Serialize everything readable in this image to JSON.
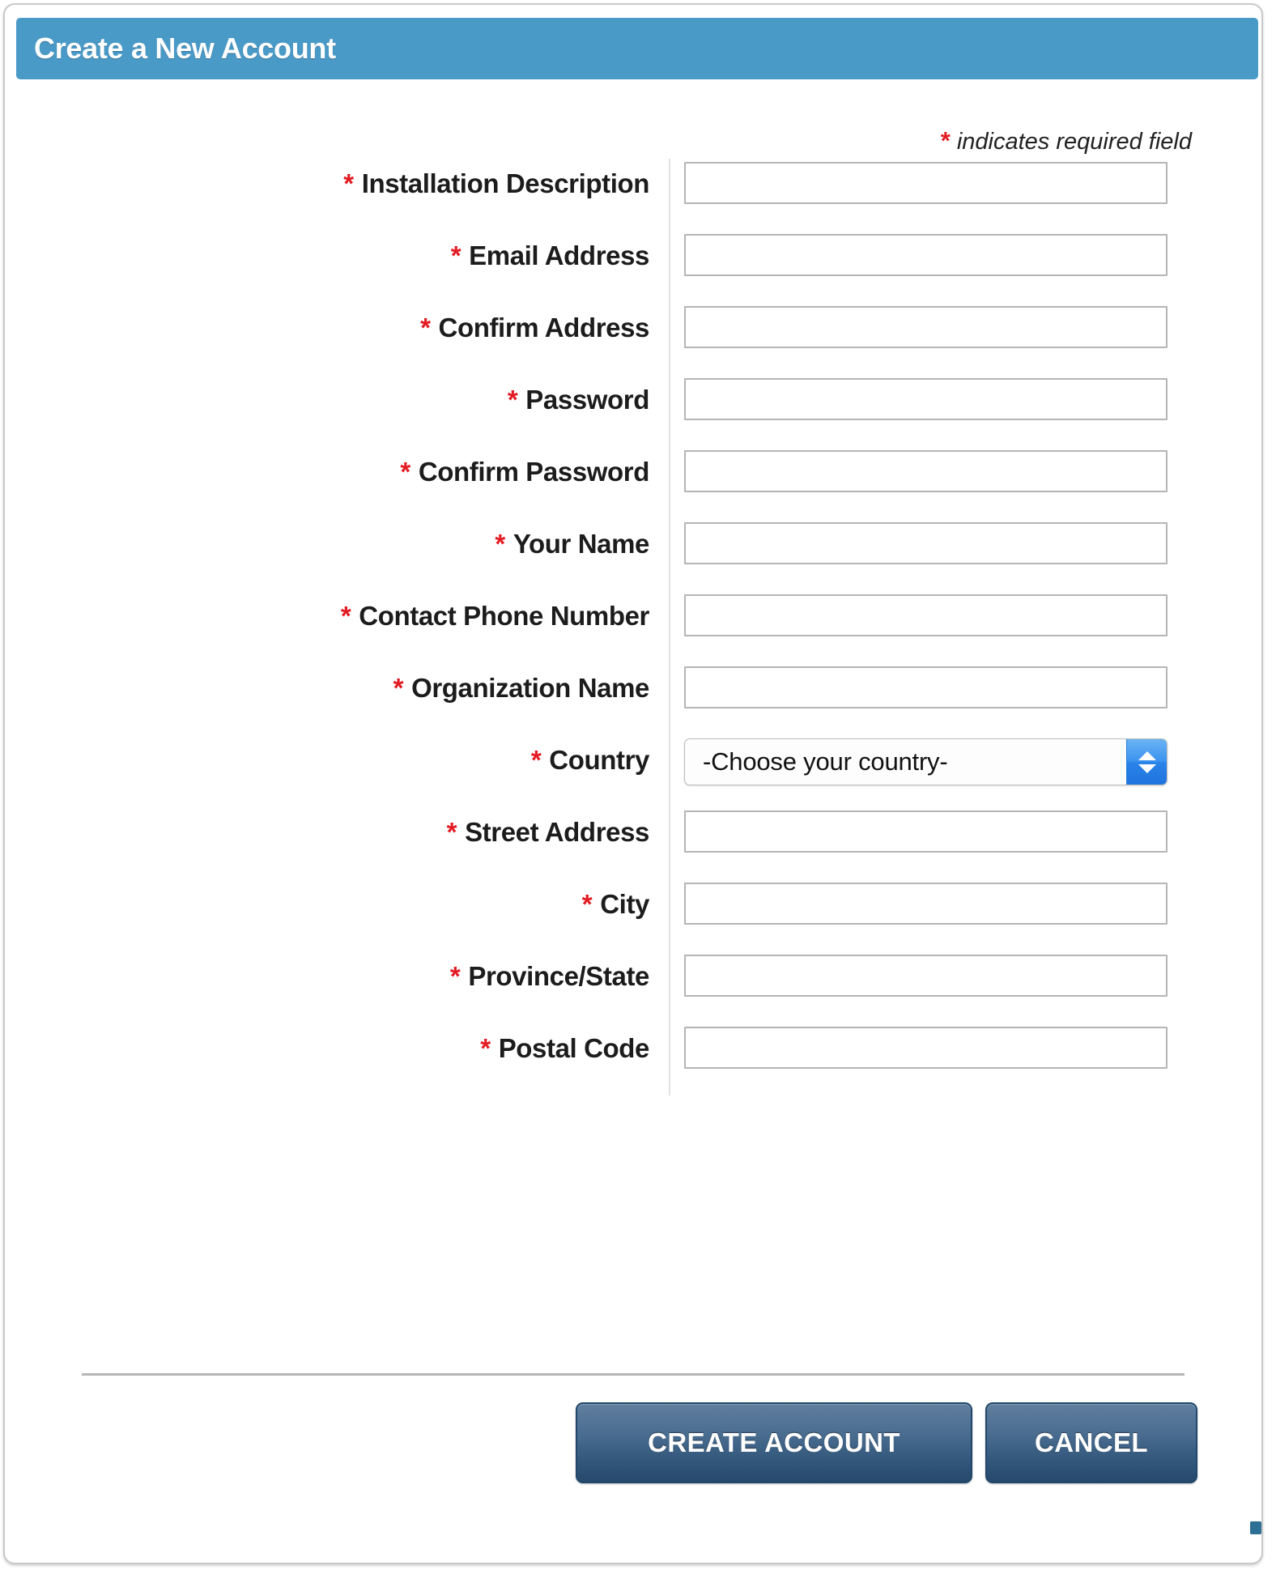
{
  "header": {
    "title": "Create a New Account",
    "background_color": "#4a9ac8",
    "text_color": "#ffffff"
  },
  "required_note": {
    "marker": "*",
    "text": "indicates required field",
    "marker_color": "#e31b23"
  },
  "form": {
    "required_marker": "*",
    "fields": [
      {
        "label": "Installation Description",
        "type": "text",
        "value": "",
        "required": true
      },
      {
        "label": "Email Address",
        "type": "text",
        "value": "",
        "required": true
      },
      {
        "label": "Confirm Address",
        "type": "text",
        "value": "",
        "required": true
      },
      {
        "label": "Password",
        "type": "text",
        "value": "",
        "required": true
      },
      {
        "label": "Confirm Password",
        "type": "text",
        "value": "",
        "required": true
      },
      {
        "label": "Your Name",
        "type": "text",
        "value": "",
        "required": true
      },
      {
        "label": "Contact Phone Number",
        "type": "text",
        "value": "",
        "required": true
      },
      {
        "label": "Organization Name",
        "type": "text",
        "value": "",
        "required": true
      },
      {
        "label": "Country",
        "type": "select",
        "value": "-Choose your country-",
        "required": true
      },
      {
        "label": "Street Address",
        "type": "text",
        "value": "",
        "required": true
      },
      {
        "label": "City",
        "type": "text",
        "value": "",
        "required": true
      },
      {
        "label": "Province/State",
        "type": "text",
        "value": "",
        "required": true
      },
      {
        "label": "Postal Code",
        "type": "text",
        "value": "",
        "required": true
      }
    ]
  },
  "country_select": {
    "selected": "-Choose your country-",
    "stepper_icon": "up-down-chevron-icon",
    "stepper_color": "#2a83e8"
  },
  "footer": {
    "create_label": "CREATE ACCOUNT",
    "cancel_label": "CANCEL",
    "button_color": "#33587c"
  }
}
